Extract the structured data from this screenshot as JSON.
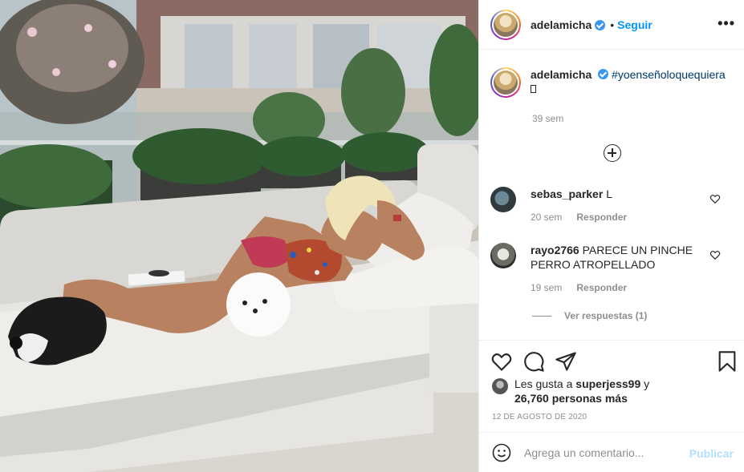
{
  "header": {
    "username": "adelamicha",
    "separator": "•",
    "follow_label": "Seguir",
    "more_label": "•••"
  },
  "caption": {
    "username": "adelamicha",
    "hashtag": "#yoenseñoloquequiera",
    "time": "39 sem"
  },
  "comments": [
    {
      "username": "sebas_parker",
      "text": "L",
      "time": "20 sem",
      "reply_label": "Responder"
    },
    {
      "username": "rayo2766",
      "text": "PARECE UN PINCHE PERRO ATROPELLADO",
      "time": "19 sem",
      "reply_label": "Responder"
    }
  ],
  "view_replies_label": "Ver respuestas (1)",
  "likes": {
    "prefix": "Les gusta a",
    "liker": "superjess99",
    "connector": "y",
    "others": "26,760 personas más"
  },
  "date": "12 DE AGOSTO DE 2020",
  "add_comment": {
    "placeholder": "Agrega un comentario...",
    "publish_label": "Publicar"
  },
  "colors": {
    "link_blue": "#0095f6",
    "verified_blue": "#3897f0",
    "publish_disabled": "#b2dffc",
    "muted_text": "#8e8e8e"
  },
  "icons": [
    "verified-badge-icon",
    "more-options-icon",
    "load-more-icon",
    "heart-icon",
    "comment-icon",
    "share-icon",
    "bookmark-icon",
    "emoji-icon"
  ]
}
